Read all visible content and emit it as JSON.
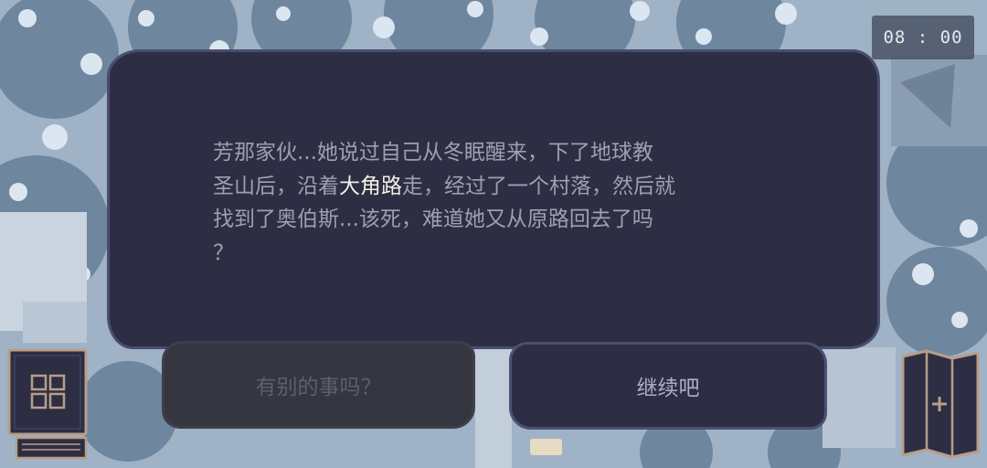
{
  "clock": {
    "time": "08 : 00"
  },
  "dialog": {
    "text_before": "芳那家伙...她说过自己从冬眠醒来，下了地球教\n圣山后，沿着",
    "highlight": "大角路",
    "text_after": "走，经过了一个村落，然后就\n找到了奥伯斯...该死，难道她又从原路回去了吗\n？",
    "text_color": "#9d9fb3",
    "highlight_color": "#f0efe6",
    "panel_color": "#2d2e43"
  },
  "choices": [
    {
      "label": "有别的事吗？",
      "state": "disabled"
    },
    {
      "label": "继续吧",
      "state": "enabled"
    }
  ],
  "buttons": {
    "journal": {
      "icon": "grid-icon"
    },
    "map": {
      "icon": "map-icon"
    }
  }
}
